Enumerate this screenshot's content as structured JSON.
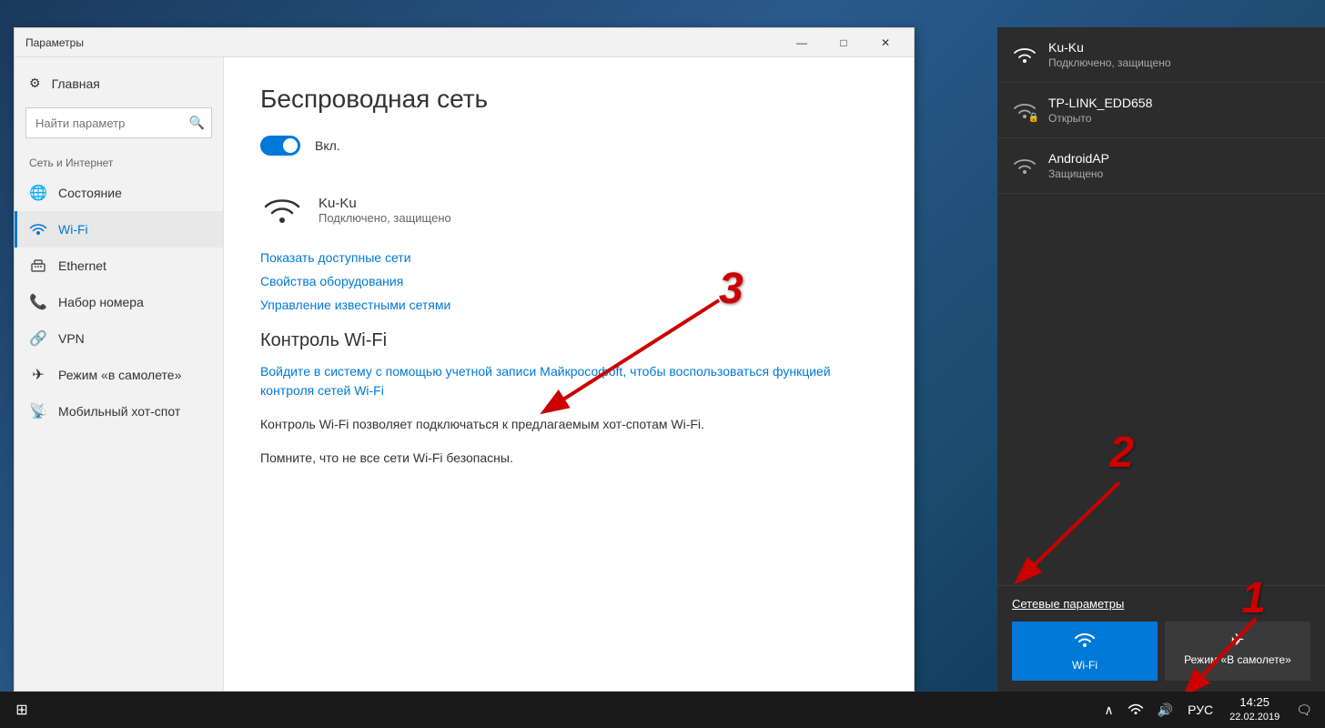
{
  "window": {
    "title": "Параметры",
    "controls": {
      "minimize": "—",
      "maximize": "□",
      "close": "✕"
    }
  },
  "sidebar": {
    "home_label": "Главная",
    "search_placeholder": "Найти параметр",
    "section_label": "Сеть и Интернет",
    "nav_items": [
      {
        "id": "status",
        "label": "Состояние",
        "icon": "🌐"
      },
      {
        "id": "wifi",
        "label": "Wi-Fi",
        "icon": "📶",
        "active": true
      },
      {
        "id": "ethernet",
        "label": "Ethernet",
        "icon": "🖥"
      },
      {
        "id": "dialup",
        "label": "Набор номера",
        "icon": "📞"
      },
      {
        "id": "vpn",
        "label": "VPN",
        "icon": "🔗"
      },
      {
        "id": "airplane",
        "label": "Режим «в самолете»",
        "icon": "✈"
      },
      {
        "id": "hotspot",
        "label": "Мобильный хот-спот",
        "icon": "📡"
      }
    ]
  },
  "main": {
    "page_title": "Беспроводная сеть",
    "toggle_label": "Вкл.",
    "network": {
      "name": "Ku-Ku",
      "status": "Подключено, защищено"
    },
    "links": {
      "show_networks": "Показать доступные сети",
      "adapter_props": "Свойства оборудования",
      "manage_networks": "Управление известными сетями"
    },
    "wifi_control": {
      "section_title": "Контроль Wi-Fi",
      "login_link": "Войдите в систему с помощью учетной записи Майкрософoft, чтобы воспользоваться функцией контроля сетей Wi-Fi",
      "description1": "Контроль Wi-Fi позволяет подключаться к предлагаемым хот-спотам Wi-Fi.",
      "description2": "Помните, что не все сети Wi-Fi безопасны."
    }
  },
  "flyout": {
    "networks": [
      {
        "name": "Ku-Ku",
        "status": "Подключено, защищено",
        "icon": "wifi",
        "connected": true
      },
      {
        "name": "TP-LINK_EDD658",
        "status": "Открыто",
        "icon": "wifi-lock",
        "connected": false
      },
      {
        "name": "AndroidAP",
        "status": "Защищено",
        "icon": "wifi",
        "connected": false
      }
    ],
    "network_settings_label": "Сетевые параметры",
    "quick_actions": [
      {
        "id": "wifi",
        "label": "Wi-Fi",
        "icon": "📶",
        "active": true
      },
      {
        "id": "airplane",
        "label": "Режим «В самолете»",
        "icon": "✈",
        "active": false
      }
    ]
  },
  "taskbar": {
    "language": "РУС",
    "time": "14:25",
    "date": "22.02.2019"
  },
  "annotations": {
    "num1": "1",
    "num2": "2",
    "num3": "3"
  }
}
